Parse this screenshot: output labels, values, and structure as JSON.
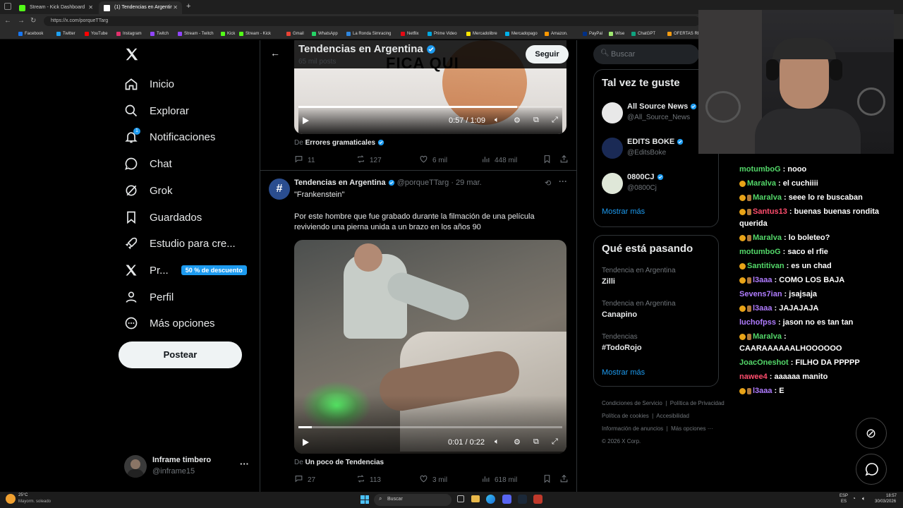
{
  "browser": {
    "tabs": [
      {
        "title": "Stream - Kick Dashboard",
        "color": "#53fc18"
      },
      {
        "title": "(1) Tendencias en Argentina (@po…",
        "color": "#ffffff"
      }
    ],
    "url": "https://x.com/porqueTTarg",
    "bookmarks": [
      "Facebook",
      "Twitter",
      "YouTube",
      "Instagram",
      "Twitch",
      "Stream - Twitch",
      "Kick",
      "Stream - Kick",
      "Gmail",
      "WhatsApp",
      "La Ronda Simracing",
      "Netflix",
      "Prime Video",
      "Mercadolibre",
      "Mercadopago",
      "Amazon.",
      "PayPal",
      "Wise",
      "ChatGPT",
      "OFERTAS RIKY S"
    ]
  },
  "sidebar": {
    "items": [
      {
        "label": "Inicio",
        "icon": "home-icon"
      },
      {
        "label": "Explorar",
        "icon": "search-icon"
      },
      {
        "label": "Notificaciones",
        "icon": "bell-icon",
        "badge": "1"
      },
      {
        "label": "Chat",
        "icon": "chat-icon"
      },
      {
        "label": "Grok",
        "icon": "grok-icon"
      },
      {
        "label": "Guardados",
        "icon": "bookmark-icon"
      },
      {
        "label": "Estudio para cre...",
        "icon": "rocket-icon"
      },
      {
        "label": "Pr...",
        "icon": "x-premium-icon",
        "promo": "50 % de descuento"
      },
      {
        "label": "Perfil",
        "icon": "person-icon"
      },
      {
        "label": "Más opciones",
        "icon": "more-circle-icon"
      }
    ],
    "post_button": "Postear",
    "account": {
      "name": "Inframe timbero",
      "handle": "@inframe15"
    }
  },
  "header": {
    "title": "Tendencias en Argentina",
    "subtitle": "65 mil posts",
    "follow": "Seguir"
  },
  "post1": {
    "video_caption": "FICA QUI",
    "time": "0:57 / 1:09",
    "progress": 0.83,
    "source_prefix": "De",
    "source": "Errores gramaticales",
    "stats": {
      "replies": "11",
      "reposts": "127",
      "likes": "6 mil",
      "views": "448 mil"
    }
  },
  "post2": {
    "author": "Tendencias en Argentina",
    "handle": "@porqueTTarg",
    "date": "· 29 mar.",
    "title": "\"Frankenstein\"",
    "text": "Por este hombre que fue grabado durante la filmación de una película reviviendo una pierna unida a un brazo en los años 90",
    "time": "0:01 / 0:22",
    "progress": 0.05,
    "source_prefix": "De",
    "source": "Un poco de Tendencias",
    "stats": {
      "replies": "27",
      "reposts": "113",
      "likes": "3 mil",
      "views": "618 mil"
    }
  },
  "right": {
    "search_placeholder": "Buscar",
    "suggest_title": "Tal vez te guste",
    "suggestions": [
      {
        "name": "All Source News",
        "handle": "@All_Source_News"
      },
      {
        "name": "EDITS BOKE",
        "handle": "@EditsBoke"
      },
      {
        "name": "0800CJ",
        "handle": "@0800Cj"
      }
    ],
    "show_more": "Mostrar más",
    "trends_title": "Qué está pasando",
    "trends": [
      {
        "category": "Tendencia en Argentina",
        "name": "Zilli"
      },
      {
        "category": "Tendencia en Argentina",
        "name": "Canapino"
      },
      {
        "category": "Tendencias",
        "name": "#TodoRojo"
      }
    ],
    "footer": [
      "Condiciones de Servicio",
      "Política de Privacidad",
      "Política de cookies",
      "Accesibilidad",
      "Información de anuncios",
      "Más opciones ···",
      "© 2026 X Corp."
    ]
  },
  "chat": [
    {
      "user": "motumboG",
      "color": "#53d769",
      "msg": ": nooo",
      "badges": 0
    },
    {
      "user": "Maralva",
      "color": "#53d769",
      "msg": ": el cuchiiii",
      "badges": 1
    },
    {
      "user": "Maralva",
      "color": "#53d769",
      "msg": ": seee lo re buscaban",
      "badges": 2
    },
    {
      "user": "Santus13",
      "color": "#ff4d6d",
      "msg": ": buenas buenas rondita",
      "badges": 2,
      "cont": "querida"
    },
    {
      "user": "Maralva",
      "color": "#53d769",
      "msg": ": lo boleteo?",
      "badges": 2
    },
    {
      "user": "motumboG",
      "color": "#53d769",
      "msg": ": saco el rfie",
      "badges": 0
    },
    {
      "user": "Santitivan",
      "color": "#53d769",
      "msg": ": es un chad",
      "badges": 1
    },
    {
      "user": "l3aaa",
      "color": "#b07cff",
      "msg": ": COMO LOS BAJA",
      "badges": 2
    },
    {
      "user": "Sevens7ian",
      "color": "#b07cff",
      "msg": ": jsajsaja",
      "badges": 0
    },
    {
      "user": "l3aaa",
      "color": "#b07cff",
      "msg": ": JAJAJAJA",
      "badges": 2
    },
    {
      "user": "luchofpss",
      "color": "#b07cff",
      "msg": ": jason no es tan tan",
      "badges": 0
    },
    {
      "user": "Maralva",
      "color": "#53d769",
      "msg": ":",
      "badges": 2,
      "cont": "CAARAAAAAALHOOOOOO"
    },
    {
      "user": "JoacOneshot",
      "color": "#53d769",
      "msg": ": FILHO DA PPPPP",
      "badges": 0
    },
    {
      "user": "nawee4",
      "color": "#ff4d6d",
      "msg": ": aaaaaa manito",
      "badges": 0
    },
    {
      "user": "l3aaa",
      "color": "#b07cff",
      "msg": ": E",
      "badges": 2
    }
  ],
  "taskbar": {
    "weather_temp": "25°C",
    "weather_desc": "Mayorm. soleado",
    "search": "Buscar",
    "lang": "ESP",
    "lang2": "ES",
    "time": "18:57",
    "date": "30/03/2026"
  }
}
